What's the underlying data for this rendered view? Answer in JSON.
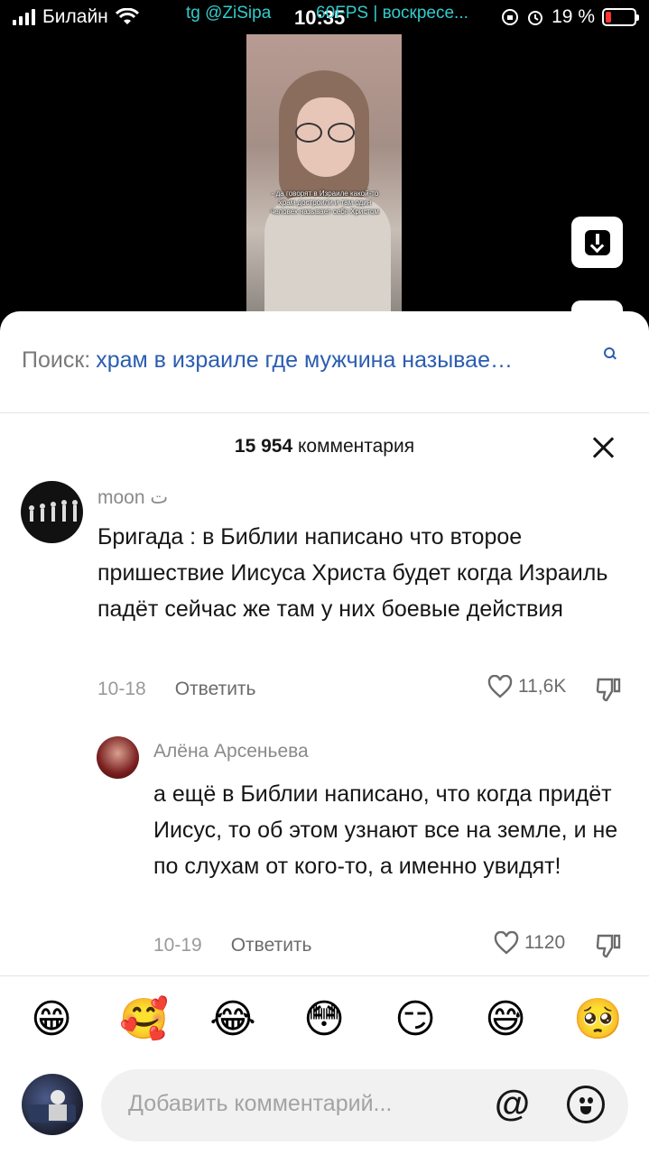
{
  "status_bar": {
    "carrier": "Билайн",
    "overlay_left": "tg @ZiSipa",
    "time": "10:35",
    "overlay_right": "60FPS | воскресе...",
    "battery": "19 %",
    "battery_level": 0.19,
    "battery_color": "#ff3333"
  },
  "video": {
    "caption": "- да говорят в Израиле какой-то храм достроили и там один человек называет себя Христом",
    "save_icon": "download-icon"
  },
  "search": {
    "label": "Поиск:",
    "query": "храм в израиле где мужчина называе…",
    "icon": "search-icon",
    "query_color": "#2a5db0"
  },
  "comments": {
    "count_number": "15 954",
    "count_label": "комментария",
    "close_icon": "close-icon",
    "items": [
      {
        "username": "moon ت",
        "text": "Бригада : в Библии написано что второе пришествие Иисуса Христа будет когда Израиль падёт сейчас же там у них боевые действия",
        "date": "10-18",
        "reply_label": "Ответить",
        "likes": "11,6K"
      },
      {
        "username": "Алёна Арсеньева",
        "text": "а ещё в Библии написано, что когда придёт Иисус, то об этом узнают все на земле, и не по слухам от кого-то, а именно увидят!",
        "date": "10-19",
        "reply_label": "Ответить",
        "likes": "1120"
      }
    ]
  },
  "emoji_bar": [
    "😁",
    "🥰",
    "😂",
    "😳",
    "😏",
    "😅",
    "🥺"
  ],
  "input": {
    "placeholder": "Добавить комментарий...",
    "at_symbol": "@",
    "mention_icon": "at-icon",
    "emoji_icon": "smile-icon"
  }
}
